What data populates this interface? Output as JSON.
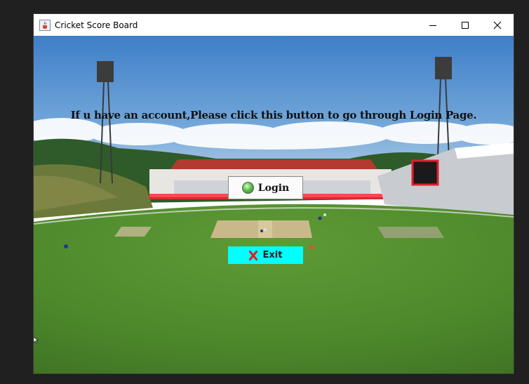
{
  "window": {
    "title": "Cricket Score Board",
    "app_icon": "java-cup-icon",
    "controls": [
      "minimize-icon",
      "maximize-icon",
      "close-icon"
    ]
  },
  "main": {
    "message": "If u have an account,Please click this button to go through Login Page.",
    "login_button": {
      "label": "Login",
      "icon": "green-orb-icon"
    },
    "exit_button": {
      "label": "Exit",
      "icon": "red-x-icon"
    },
    "background": "cricket-stadium-image"
  },
  "colors": {
    "exit_button_bg": "#00ffff",
    "exit_icon": "#e02020",
    "sky": "#4f86c6",
    "field": "#4f8a2c"
  }
}
